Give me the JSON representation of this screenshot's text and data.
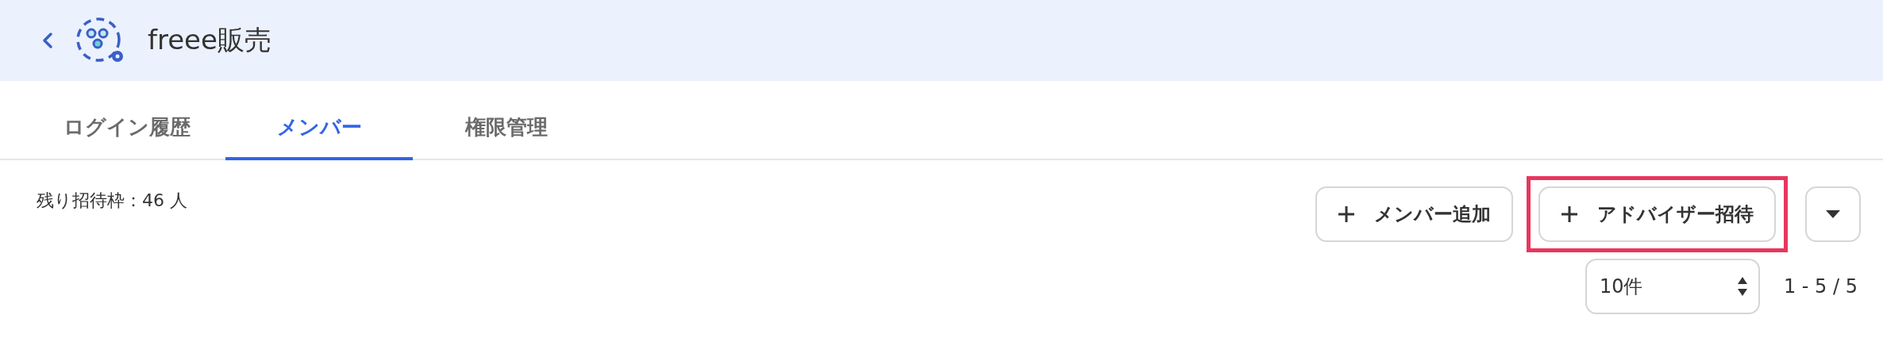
{
  "header": {
    "title": "freee販売"
  },
  "tabs": [
    {
      "label": "ログイン履歴",
      "selected": false
    },
    {
      "label": "メンバー",
      "selected": true
    },
    {
      "label": "権限管理",
      "selected": false
    }
  ],
  "quota": "残り招待枠：46 人",
  "actions": [
    {
      "label": "メンバー追加",
      "highlighted": false
    },
    {
      "label": "アドバイザー招待",
      "highlighted": true
    }
  ],
  "pagination": {
    "per_page": "10件",
    "range": "1 - 5 / 5"
  }
}
